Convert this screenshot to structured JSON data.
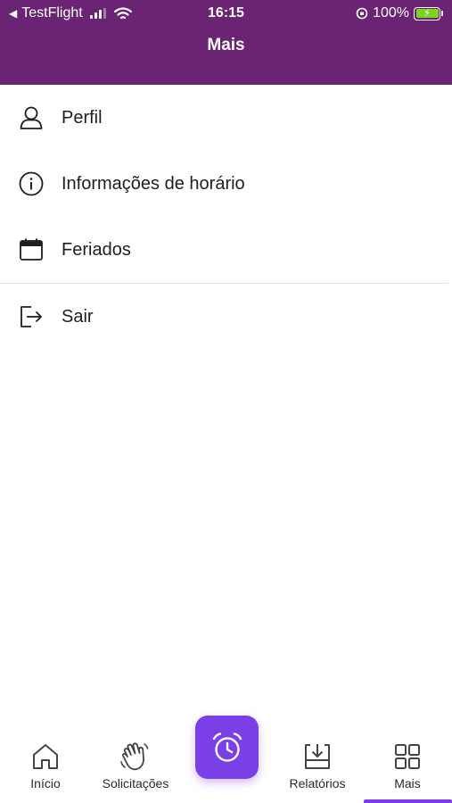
{
  "status_bar": {
    "back_app": "TestFlight",
    "time": "16:15",
    "battery_percent": "100%",
    "signal_bars": 3,
    "battery_level": 1.0
  },
  "header": {
    "title": "Mais",
    "background_color": "#6b2374"
  },
  "menu": {
    "items": [
      {
        "label": "Perfil",
        "icon": "user-icon"
      },
      {
        "label": "Informações de horário",
        "icon": "info-icon"
      },
      {
        "label": "Feriados",
        "icon": "calendar-icon"
      },
      {
        "label": "Sair",
        "icon": "logout-icon"
      }
    ]
  },
  "tabbar": {
    "tabs": [
      {
        "label": "Início",
        "icon": "home-icon",
        "active": false
      },
      {
        "label": "Solicitações",
        "icon": "hand-wave-icon",
        "active": false
      },
      {
        "label": "Relatórios",
        "icon": "download-tray-icon",
        "active": false
      },
      {
        "label": "Mais",
        "icon": "grid-icon",
        "active": true
      }
    ],
    "center_action": {
      "icon": "alarm-clock-icon",
      "color": "#7b3fe8"
    },
    "active_indicator_color": "#7c3aed"
  }
}
